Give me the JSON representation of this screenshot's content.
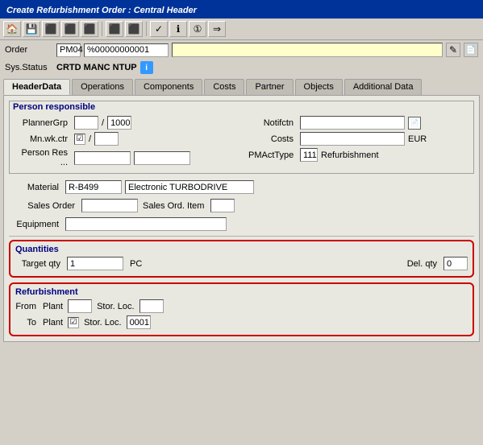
{
  "titleBar": {
    "text": "Create Refurbishment Order : Central Header"
  },
  "toolbar": {
    "buttons": [
      "🏠",
      "💾",
      "📋",
      "⚙️",
      "🔧",
      "📄",
      "📑",
      "✉️",
      "🔍",
      "❓",
      "⚡"
    ]
  },
  "orderBar": {
    "label": "Order",
    "orderType": "PM04",
    "orderNumber": "%00000000001",
    "descriptionPlaceholder": ""
  },
  "sysStatusBar": {
    "label": "Sys.Status",
    "status": "CRTD MANC NTUP"
  },
  "tabs": [
    {
      "id": "header-data",
      "label": "HeaderData",
      "active": true
    },
    {
      "id": "operations",
      "label": "Operations",
      "active": false
    },
    {
      "id": "components",
      "label": "Components",
      "active": false
    },
    {
      "id": "costs",
      "label": "Costs",
      "active": false
    },
    {
      "id": "partner",
      "label": "Partner",
      "active": false
    },
    {
      "id": "objects",
      "label": "Objects",
      "active": false
    },
    {
      "id": "additional-data",
      "label": "Additional Data",
      "active": false
    }
  ],
  "personResponsible": {
    "title": "Person responsible",
    "fields": {
      "plannerGrp": {
        "label": "PlannerGrp",
        "value": "",
        "separator": "/",
        "value2": "1000"
      },
      "mnWkCtr": {
        "label": "Mn.wk.ctr",
        "checked": true,
        "separator": "/",
        "value": ""
      },
      "personRes": {
        "label": "Person Res ...",
        "value1": "",
        "value2": ""
      }
    },
    "rightFields": {
      "notifctn": {
        "label": "Notifctn",
        "value": ""
      },
      "costs": {
        "label": "Costs",
        "value": "",
        "currency": "EUR"
      },
      "pmActType": {
        "label": "PMActType",
        "value": "111",
        "description": "Refurbishment"
      }
    }
  },
  "materialRow": {
    "label": "Material",
    "materialCode": "R-B499",
    "description": "Electronic TURBODRIVE"
  },
  "salesOrder": {
    "label": "Sales Order",
    "value": ""
  },
  "salesOrdItem": {
    "label": "Sales Ord. Item",
    "value": ""
  },
  "equipment": {
    "label": "Equipment",
    "value": ""
  },
  "quantities": {
    "title": "Quantities",
    "targetQty": {
      "label": "Target qty",
      "value": "1",
      "unit": "PC"
    },
    "delQty": {
      "label": "Del. qty",
      "value": "0"
    }
  },
  "refurbishment": {
    "title": "Refurbishment",
    "from": {
      "label": "From",
      "plantLabel": "Plant",
      "plantValue": "",
      "storLocLabel": "Stor. Loc.",
      "storLocValue": ""
    },
    "to": {
      "label": "To",
      "plantLabel": "Plant",
      "checked": true,
      "storLocLabel": "Stor. Loc.",
      "storLocValue": "0001"
    }
  }
}
